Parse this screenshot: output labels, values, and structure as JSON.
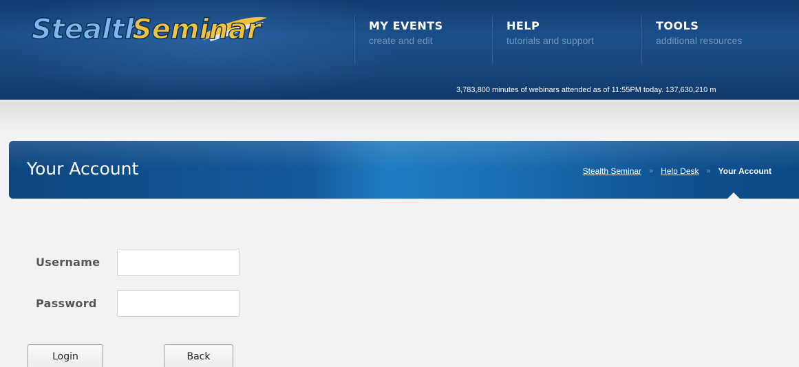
{
  "header": {
    "logo_text": "StealthSeminar",
    "nav": [
      {
        "title": "MY EVENTS",
        "subtitle": "create and edit"
      },
      {
        "title": "HELP",
        "subtitle": "tutorials and support"
      },
      {
        "title": "TOOLS",
        "subtitle": "additional resources"
      }
    ],
    "ticker": "3,783,800 minutes of webinars attended as of 11:55PM today. 137,630,210 m"
  },
  "banner": {
    "title": "Your Account",
    "breadcrumb": {
      "items": [
        "Stealth Seminar",
        "Help Desk"
      ],
      "separator": "»",
      "current": "Your Account"
    }
  },
  "login_form": {
    "username_label": "Username",
    "username_value": "",
    "password_label": "Password",
    "password_value": "",
    "login_button": "Login",
    "back_button": "Back"
  },
  "colors": {
    "header_blue": "#1b4f8a",
    "banner_blue": "#145a9c",
    "page_bg": "#f2f2f2"
  }
}
